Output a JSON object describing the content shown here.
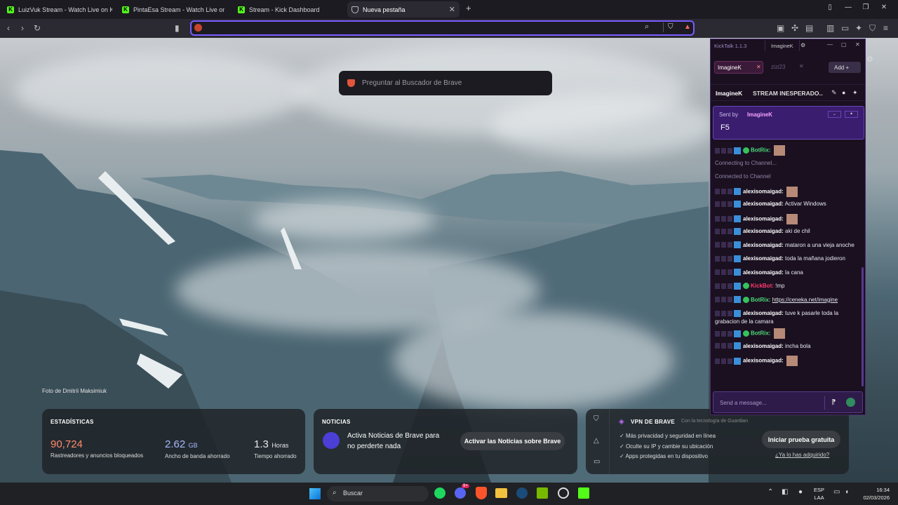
{
  "tabs": [
    {
      "label": "LuizVuk Stream - Watch Live on Kick",
      "icon": "kick-icon"
    },
    {
      "label": "PintaEsa Stream - Watch Live on",
      "icon": "kick-icon"
    },
    {
      "label": "Stream - Kick Dashboard",
      "icon": "kick-icon"
    },
    {
      "label": "Nueva pestaña",
      "icon": "brave-shield-icon"
    }
  ],
  "address": {
    "value": "",
    "placeholder": ""
  },
  "search_popup": {
    "placeholder": "Preguntar al Buscador de Brave"
  },
  "photo_credit": "Foto de Dmitrii Maksimiuk",
  "stats": {
    "title": "ESTADÍSTICAS",
    "trackers": "90,724",
    "trackers_label": "Rastreadores y anuncios bloqueados",
    "bandwidth": "2.62",
    "bandwidth_unit": "GB",
    "bandwidth_label": "Ancho de banda ahorrado",
    "time": "1.3",
    "time_unit": "Horas",
    "time_label": "Tiempo ahorrado"
  },
  "news": {
    "title": "NOTICIAS",
    "text": "Activa Noticias de Brave para no perderte nada",
    "button": "Activar las Noticias sobre Brave"
  },
  "vpn": {
    "title": "VPN DE BRAVE",
    "powered": "Con la tecnología de",
    "guardian": "Guardian",
    "f1": "Más privacidad y seguridad en línea",
    "f2": "Oculte su IP y cambie su ubicación",
    "f3": "Apps protegidas en tu dispositivo",
    "button": "Iniciar prueba gratuita",
    "link": "¿Ya lo has adquirido?"
  },
  "kicktalk": {
    "title": "KickTalk 1.1.3",
    "user": "ImagineK",
    "tabs": [
      {
        "label": "ImagineK"
      },
      {
        "label": "zizi23"
      }
    ],
    "add": "Add",
    "channel": "ImagineK",
    "stream_title": "STREAM INESPERADO...",
    "pinned": {
      "sent_by": "Sent by",
      "author": "ImagineK",
      "text": "F5"
    },
    "messages": [
      {
        "user": "BotRix:",
        "text": "",
        "type": "bot",
        "emote": true
      },
      {
        "user": "",
        "text": "Connecting to Channel...",
        "type": "sys"
      },
      {
        "user": "",
        "text": "Connected to Channel",
        "type": "sys"
      },
      {
        "user": "alexisomaigad:",
        "text": "",
        "type": "user",
        "emote": true
      },
      {
        "user": "alexisomaigad:",
        "text": "Activar Windows",
        "type": "user"
      },
      {
        "user": "alexisomaigad:",
        "text": "",
        "type": "user",
        "emote": true
      },
      {
        "user": "alexisomaigad:",
        "text": "aki de chil",
        "type": "user"
      },
      {
        "user": "alexisomaigad:",
        "text": "mataron a una vieja anoche",
        "type": "user"
      },
      {
        "user": "alexisomaigad:",
        "text": "toda la mañana jodieron",
        "type": "user"
      },
      {
        "user": "alexisomaigad:",
        "text": "la cana",
        "type": "user"
      },
      {
        "user": "KickBot:",
        "text": "!mp",
        "type": "kickbot"
      },
      {
        "user": "BotRix:",
        "text": "https://ceneka.net/imagine",
        "type": "bot"
      },
      {
        "user": "alexisomaigad:",
        "text": "tuve k pasarle toda la grabacion de la camara",
        "type": "user"
      },
      {
        "user": "BotRix:",
        "text": "",
        "type": "bot",
        "emote": true
      },
      {
        "user": "alexisomaigad:",
        "text": "incha bola",
        "type": "user"
      },
      {
        "user": "alexisomaigad:",
        "text": "",
        "type": "user",
        "emote": true
      }
    ],
    "input_placeholder": "Send a message..."
  },
  "taskbar": {
    "search": "Buscar",
    "lang": "ESP",
    "lang2": "LAA",
    "time": "16:34",
    "date": "02/03/2026",
    "badge": "9+"
  },
  "colors": {
    "accent": "#7b5cff",
    "kick": "#53fc18",
    "stat_red": "#ff8a6b",
    "stat_blue": "#a7b8ff"
  }
}
